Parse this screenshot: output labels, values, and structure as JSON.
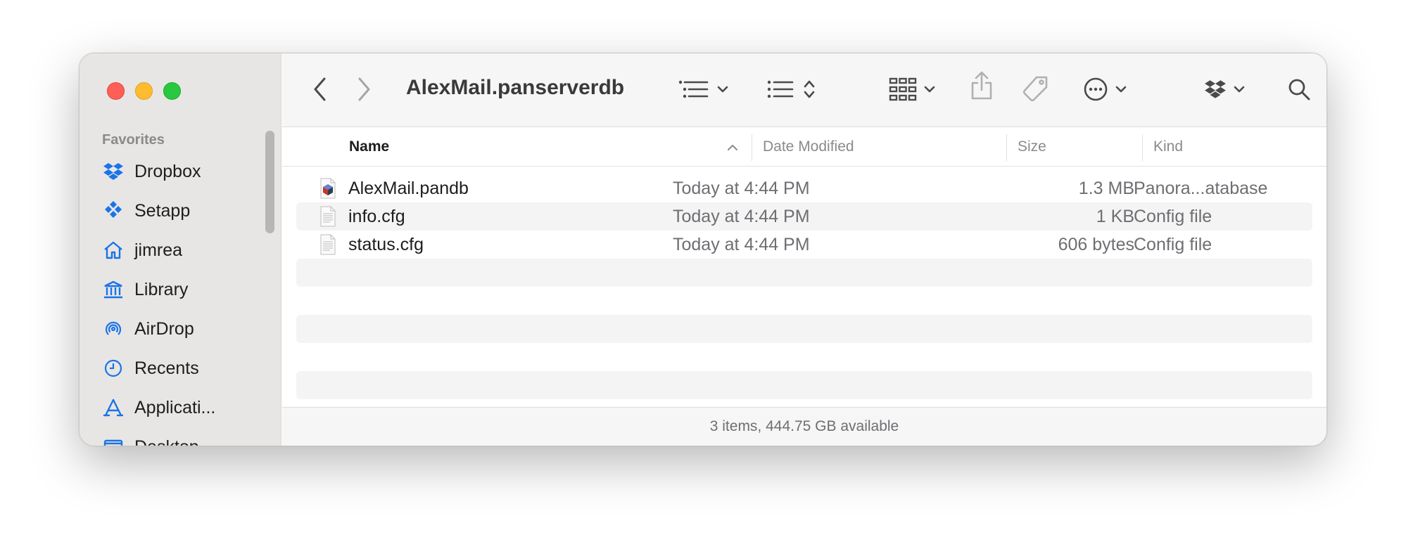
{
  "window": {
    "title": "AlexMail.panserverdb"
  },
  "sidebar": {
    "section_label": "Favorites",
    "items": [
      {
        "label": "Dropbox",
        "icon": "dropbox-icon"
      },
      {
        "label": "Setapp",
        "icon": "setapp-icon"
      },
      {
        "label": "jimrea",
        "icon": "home-icon"
      },
      {
        "label": "Library",
        "icon": "library-icon"
      },
      {
        "label": "AirDrop",
        "icon": "airdrop-icon"
      },
      {
        "label": "Recents",
        "icon": "clock-icon"
      },
      {
        "label": "Applicati...",
        "icon": "applications-icon"
      },
      {
        "label": "Desktop",
        "icon": "desktop-icon"
      }
    ]
  },
  "toolbar": {
    "back_icon": "chevron-left-icon",
    "forward_icon": "chevron-right-icon",
    "view_icon": "list-view-icon",
    "group_icon": "group-icon",
    "grid_icon": "grid-icon",
    "share_icon": "share-icon",
    "tag_icon": "tag-icon",
    "more_icon": "ellipsis-circle-icon",
    "dropbox_icon": "dropbox-icon",
    "search_icon": "search-icon"
  },
  "columns": {
    "name": "Name",
    "date": "Date Modified",
    "size": "Size",
    "kind": "Kind"
  },
  "files": [
    {
      "name": "AlexMail.pandb",
      "date": "Today at 4:44 PM",
      "size": "1.3 MB",
      "kind": "Panora...atabase",
      "icon": "database-file-icon"
    },
    {
      "name": "info.cfg",
      "date": "Today at 4:44 PM",
      "size": "1 KB",
      "kind": "Config file",
      "icon": "text-file-icon"
    },
    {
      "name": "status.cfg",
      "date": "Today at 4:44 PM",
      "size": "606 bytes",
      "kind": "Config file",
      "icon": "text-file-icon"
    }
  ],
  "status": {
    "text": "3 items, 444.75 GB available"
  },
  "colors": {
    "accent": "#1a73e8",
    "close": "#ff5f57",
    "minimize": "#febc2e",
    "zoom": "#28c840"
  }
}
